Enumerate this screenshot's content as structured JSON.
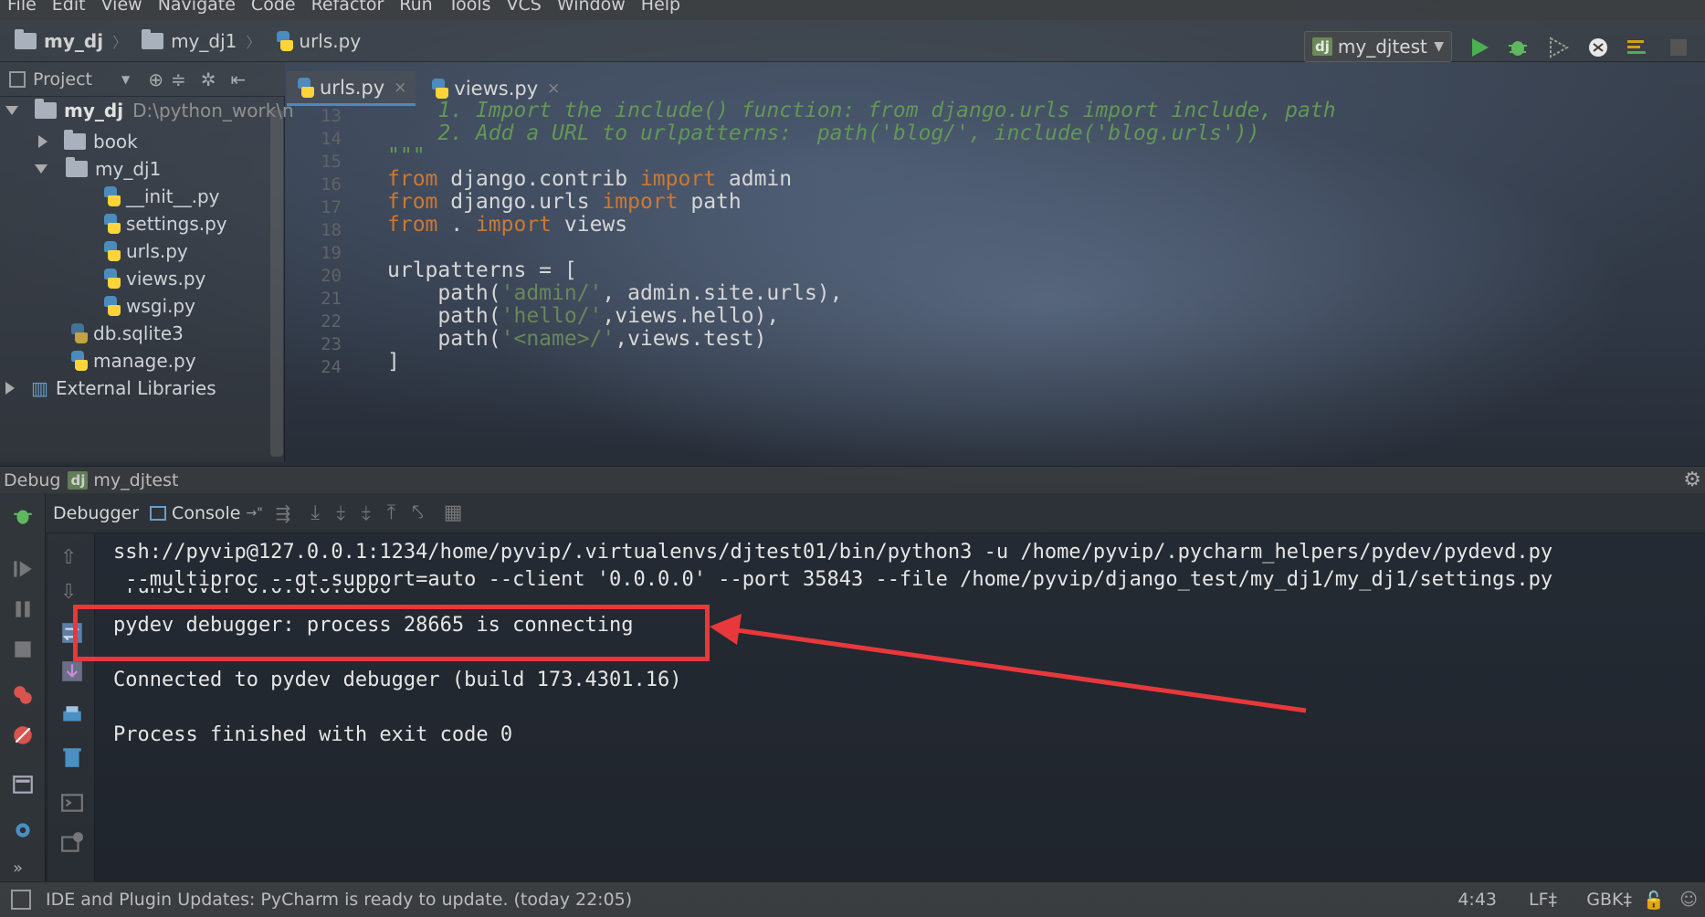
{
  "menu": [
    "File",
    "Edit",
    "View",
    "Navigate",
    "Code",
    "Refactor",
    "Run",
    "Tools",
    "VCS",
    "Window",
    "Help"
  ],
  "breadcrumb": {
    "root": "my_dj",
    "folder": "my_dj1",
    "file": "urls.py"
  },
  "run_config": {
    "badge": "dj",
    "name": "my_djtest"
  },
  "project_panel": {
    "title": "Project",
    "tree": [
      {
        "label": "my_dj",
        "path": "D:\\python_work\\n"
      },
      {
        "label": "book"
      },
      {
        "label": "my_dj1"
      },
      {
        "label": "__init__.py"
      },
      {
        "label": "settings.py"
      },
      {
        "label": "urls.py"
      },
      {
        "label": "views.py"
      },
      {
        "label": "wsgi.py"
      },
      {
        "label": "db.sqlite3"
      },
      {
        "label": "manage.py"
      },
      {
        "label": "External Libraries"
      }
    ]
  },
  "tabs": [
    {
      "label": "urls.py",
      "close": "×",
      "active": true
    },
    {
      "label": "views.py",
      "close": "×",
      "active": false
    }
  ],
  "editor": {
    "line_numbers": [
      "13",
      "14",
      "15",
      "16",
      "17",
      "18",
      "19",
      "20",
      "21",
      "22",
      "23",
      "24"
    ],
    "lines": [
      {
        "tokens": [
          {
            "t": "    1. Import the include() function: from django.urls import include, path",
            "c": "cmt"
          }
        ]
      },
      {
        "tokens": [
          {
            "t": "    2. Add a URL to urlpatterns:  path('blog/', include('blog.urls'))",
            "c": "cmt"
          }
        ]
      },
      {
        "tokens": [
          {
            "t": "\"\"\"",
            "c": "cmt"
          }
        ]
      },
      {
        "tokens": [
          {
            "t": "from",
            "c": "kw"
          },
          {
            "t": " django.contrib ",
            "c": ""
          },
          {
            "t": "import",
            "c": "kw"
          },
          {
            "t": " admin",
            "c": ""
          }
        ]
      },
      {
        "tokens": [
          {
            "t": "from",
            "c": "kw"
          },
          {
            "t": " django.urls ",
            "c": ""
          },
          {
            "t": "import",
            "c": "kw"
          },
          {
            "t": " path",
            "c": ""
          }
        ]
      },
      {
        "tokens": [
          {
            "t": "from",
            "c": "kw"
          },
          {
            "t": " . ",
            "c": ""
          },
          {
            "t": "import",
            "c": "kw"
          },
          {
            "t": " views",
            "c": ""
          }
        ]
      },
      {
        "tokens": []
      },
      {
        "tokens": [
          {
            "t": "urlpatterns = [",
            "c": ""
          }
        ]
      },
      {
        "tokens": [
          {
            "t": "    path(",
            "c": ""
          },
          {
            "t": "'admin/'",
            "c": "str"
          },
          {
            "t": ", admin.site.urls),",
            "c": ""
          }
        ]
      },
      {
        "tokens": [
          {
            "t": "    path(",
            "c": ""
          },
          {
            "t": "'hello/'",
            "c": "str"
          },
          {
            "t": ",views.hello),",
            "c": ""
          }
        ]
      },
      {
        "tokens": [
          {
            "t": "    path(",
            "c": ""
          },
          {
            "t": "'<name>/'",
            "c": "str"
          },
          {
            "t": ",views.test)",
            "c": ""
          }
        ]
      },
      {
        "tokens": [
          {
            "t": "]",
            "c": ""
          }
        ]
      }
    ]
  },
  "debug": {
    "title": "Debug",
    "badge": "dj",
    "config": "my_djtest",
    "tab_debugger": "Debugger",
    "tab_console": "Console",
    "tab_console_suffix": "→\"",
    "console_lines": [
      "ssh://pyvip@127.0.0.1:1234/home/pyvip/.virtualenvs/djtest01/bin/python3 -u /home/pyvip/.pycharm_helpers/pydev/pydevd.py",
      " --multiproc --qt-support=auto --client '0.0.0.0' --port 35843 --file /home/pyvip/django_test/my_dj1/my_dj1/settings.py",
      " runserver 0.0.0.0:8000",
      "pydev debugger: process 28665 is connecting",
      "Connected to pydev debugger (build 173.4301.16)",
      "Process finished with exit code 0"
    ],
    "annotation_color": "#e8383b"
  },
  "status": {
    "message": "IDE and Plugin Updates: PyCharm is ready to update. (today 22:05)",
    "position": "4:43",
    "line_sep": "LF‡",
    "encoding": "GBK‡"
  }
}
